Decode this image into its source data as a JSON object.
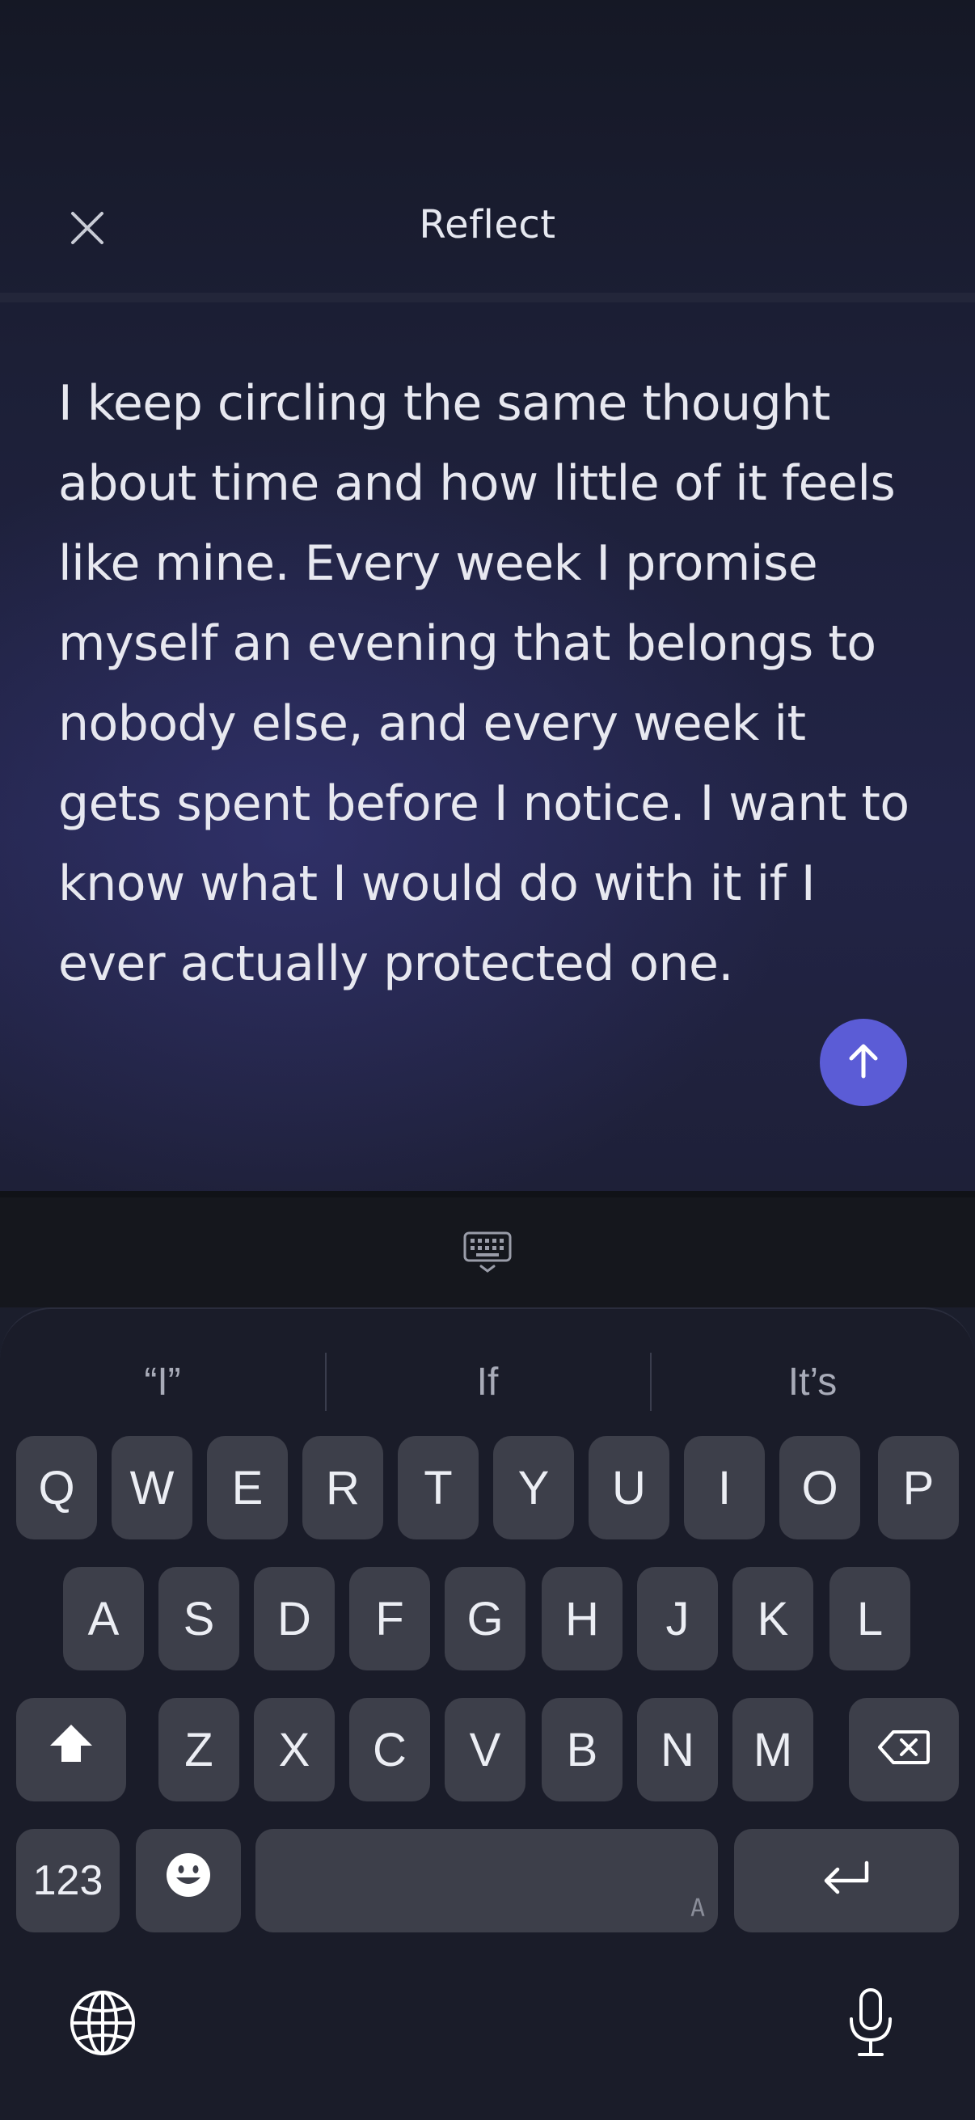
{
  "header": {
    "title": "Reflect",
    "close_icon": "close-icon"
  },
  "entry": {
    "text": "I keep circling the same thought about time and how little of it feels like mine. Every week I promise myself an evening that belongs to nobody else, and every week it gets spent before I notice. I want to know what I would do with it if I ever actually protected one."
  },
  "send": {
    "icon": "arrow-up-icon",
    "color": "#5b5cd6"
  },
  "keyboard": {
    "suggestions": [
      "“I”",
      "If",
      "It’s"
    ],
    "row1": [
      "Q",
      "W",
      "E",
      "R",
      "T",
      "Y",
      "U",
      "I",
      "O",
      "P"
    ],
    "row2": [
      "A",
      "S",
      "D",
      "F",
      "G",
      "H",
      "J",
      "K",
      "L"
    ],
    "row3": [
      "Z",
      "X",
      "C",
      "V",
      "B",
      "N",
      "M"
    ],
    "numbers_label": "123",
    "space_mark": "A"
  }
}
